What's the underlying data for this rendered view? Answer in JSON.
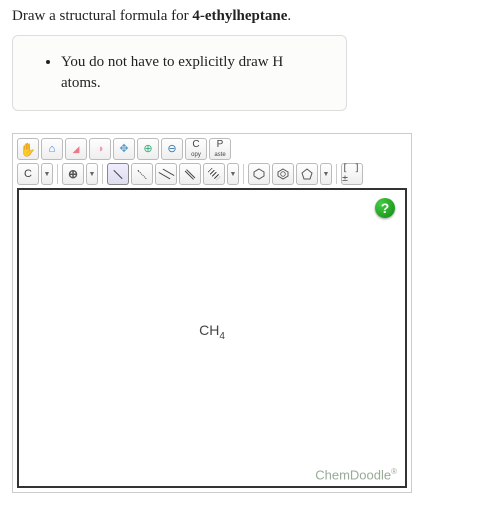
{
  "prompt": {
    "pre": "Draw a structural formula for ",
    "compound": "4-ethylheptane",
    "post": "."
  },
  "hint": {
    "items": [
      "You do not have to explicitly draw H atoms."
    ]
  },
  "toolbar1": {
    "hand": "✋",
    "home": "⌂",
    "eraser": "◢",
    "lasso": "◑",
    "move": "✥",
    "zoom_in": "⊕",
    "zoom_out": "⊖",
    "copy_label": "C",
    "copy_sub": "opy",
    "paste_label": "P",
    "paste_sub": "aste"
  },
  "toolbar2": {
    "element": "C",
    "charge": "⊕",
    "bracket": "[ ]±"
  },
  "canvas": {
    "formula_base": "CH",
    "formula_sub": "4",
    "help": "?",
    "brand": "ChemDoodle",
    "brand_mark": "®"
  }
}
